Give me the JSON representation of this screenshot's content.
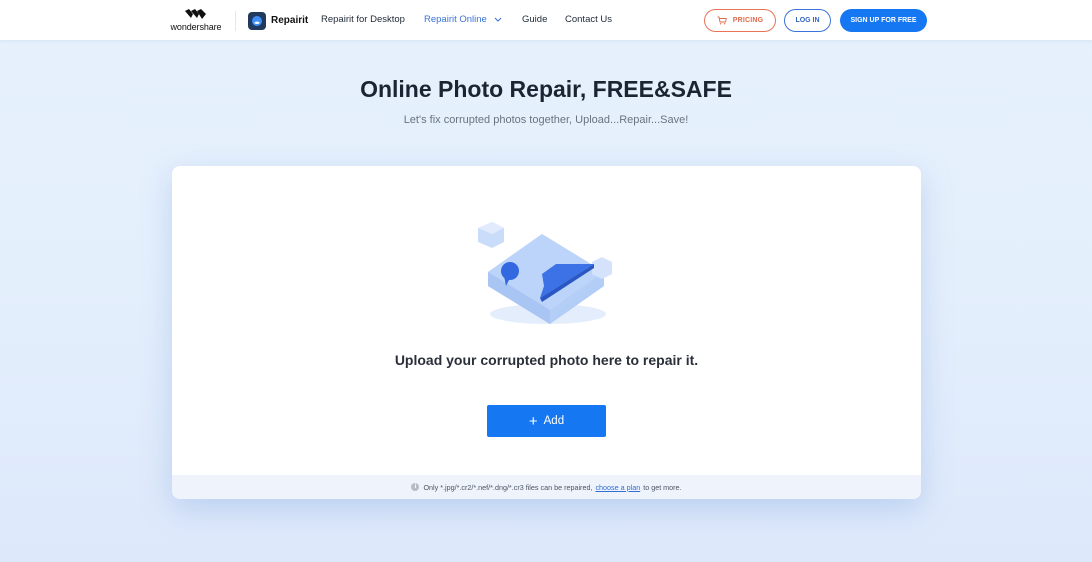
{
  "header": {
    "brand_logo_text": "wondershare",
    "product_name": "Repairit",
    "nav": [
      {
        "label": "Repairit for Desktop",
        "active": false
      },
      {
        "label": "Repairit Online",
        "active": true,
        "has_dropdown": true
      },
      {
        "label": "Guide",
        "active": false
      },
      {
        "label": "Contact Us",
        "active": false
      }
    ],
    "pricing_label": "PRICING",
    "login_label": "LOG IN",
    "signup_label": "SIGN UP FOR FREE"
  },
  "hero": {
    "title": "Online Photo Repair, FREE&SAFE",
    "subtitle": "Let's fix corrupted photos together, Upload...Repair...Save!"
  },
  "upload_card": {
    "illustration": "photo-image-icon",
    "prompt": "Upload your corrupted photo here to repair it.",
    "add_button_label": "Add",
    "add_button_icon": "plus-icon",
    "footer": {
      "info_icon": "info-icon",
      "note_prefix": "Only *.jpg/*.cr2/*.nef/*.dng/*.cr3 files can be repaired,",
      "link_text": "choose a plan",
      "note_suffix": "to get more."
    }
  },
  "colors": {
    "primary": "#1677f2",
    "pricing_accent": "#e87457",
    "nav_active": "#3b74d8",
    "title": "#1c2434"
  }
}
